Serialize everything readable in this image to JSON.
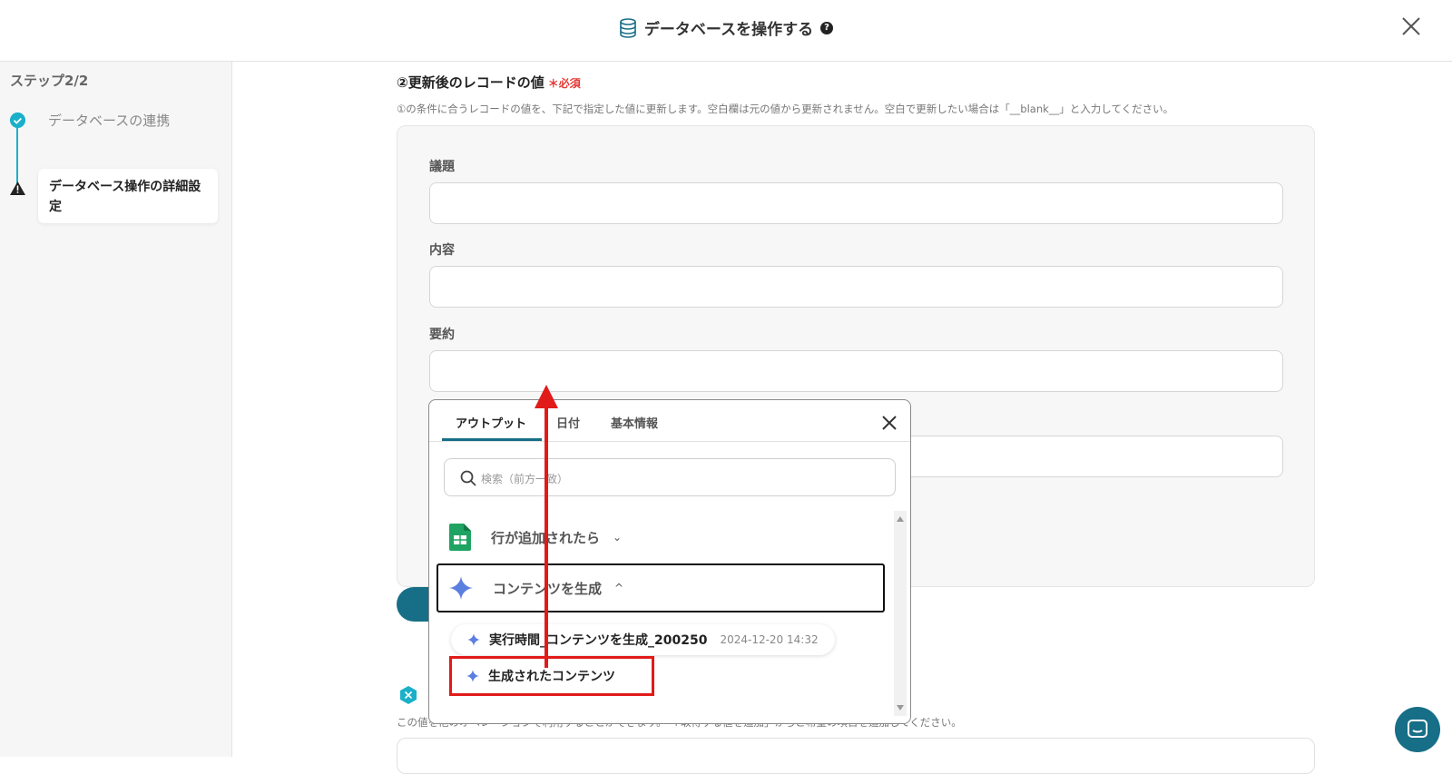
{
  "header": {
    "title": "データベースを操作する",
    "help": "?"
  },
  "sidebar": {
    "step_label": "ステップ2/2",
    "steps": [
      {
        "label": "データベースの連携",
        "status": "done"
      },
      {
        "label": "データベース操作の詳細設定",
        "status": "warning"
      }
    ]
  },
  "section": {
    "title": "②更新後のレコードの値",
    "required": "必須",
    "description": "①の条件に合うレコードの値を、下記で指定した値に更新します。空白欄は元の値から更新されません。空白で更新したい場合は「__blank__」と入力してください。",
    "fields": [
      {
        "label": "議題",
        "value": ""
      },
      {
        "label": "内容",
        "value": ""
      },
      {
        "label": "要約",
        "value": ""
      }
    ]
  },
  "section2": {
    "description": "この値を他のオペレーションで利用することができます。「+取得する値を追加」からご希望の項目を追加してください。"
  },
  "popup": {
    "tabs": [
      "アウトプット",
      "日付",
      "基本情報"
    ],
    "active_tab": "アウトプット",
    "search_placeholder": "検索（前方一致）",
    "groups": [
      {
        "label": "行が追加されたら",
        "expanded": false
      },
      {
        "label": "コンテンツを生成",
        "expanded": true
      }
    ],
    "items": [
      {
        "label": "実行時間_コンテンツを生成_200250",
        "timestamp": "2024-12-20 14:32"
      },
      {
        "label": "生成されたコンテンツ"
      }
    ]
  },
  "colors": {
    "accent": "#176e87",
    "highlight": "#e11a1a",
    "step_done": "#1ab0c9"
  }
}
